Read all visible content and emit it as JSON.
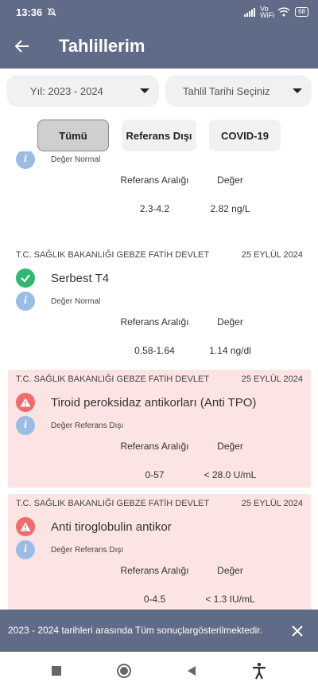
{
  "status_bar": {
    "time": "13:36",
    "network": "Vo WiFi",
    "battery": "68"
  },
  "app_bar": {
    "title": "Tahlillerim"
  },
  "filters": {
    "year": "Yıl: 2023 - 2024",
    "date": "Tahlil Tarihi Seçiniz"
  },
  "tabs": [
    "Tümü",
    "Referans Dışı",
    "COVID-19"
  ],
  "labels": {
    "ref_range": "Referans Aralığı",
    "value": "Değer"
  },
  "results": [
    {
      "status": "Değer Normal",
      "range": "2.3-4.2",
      "value": "2.82 ng/L"
    },
    {
      "hospital": "T.C. SAĞLIK BAKANLIĞI GEBZE FATİH DEVLET",
      "date": "25 EYLÜL 2024",
      "name": "Serbest T4",
      "status": "Değer Normal",
      "range": "0.58-1.64",
      "value": "1.14 ng/dl"
    },
    {
      "hospital": "T.C. SAĞLIK BAKANLIĞI GEBZE FATİH DEVLET",
      "date": "25 EYLÜL 2024",
      "name": "Tiroid peroksidaz antikorları (Anti TPO)",
      "status": "Değer Referans Dışı",
      "range": "0-57",
      "value": "< 28.0 U/mL"
    },
    {
      "hospital": "T.C. SAĞLIK BAKANLIĞI GEBZE FATİH DEVLET",
      "date": "25 EYLÜL 2024",
      "name": "Anti tiroglobulin antikor",
      "status": "Değer Referans Dışı",
      "range": "0-4.5",
      "value": "< 1.3 IU/mL"
    }
  ],
  "snackbar": {
    "message": "2023 - 2024 tarihleri arasında Tüm sonuçlargösterilmektedir."
  },
  "colors": {
    "primary": "#606c87",
    "alert_bg": "#fde4e4",
    "ok": "#2eb872",
    "warn": "#ef6c6c",
    "info": "#9bbde3"
  }
}
